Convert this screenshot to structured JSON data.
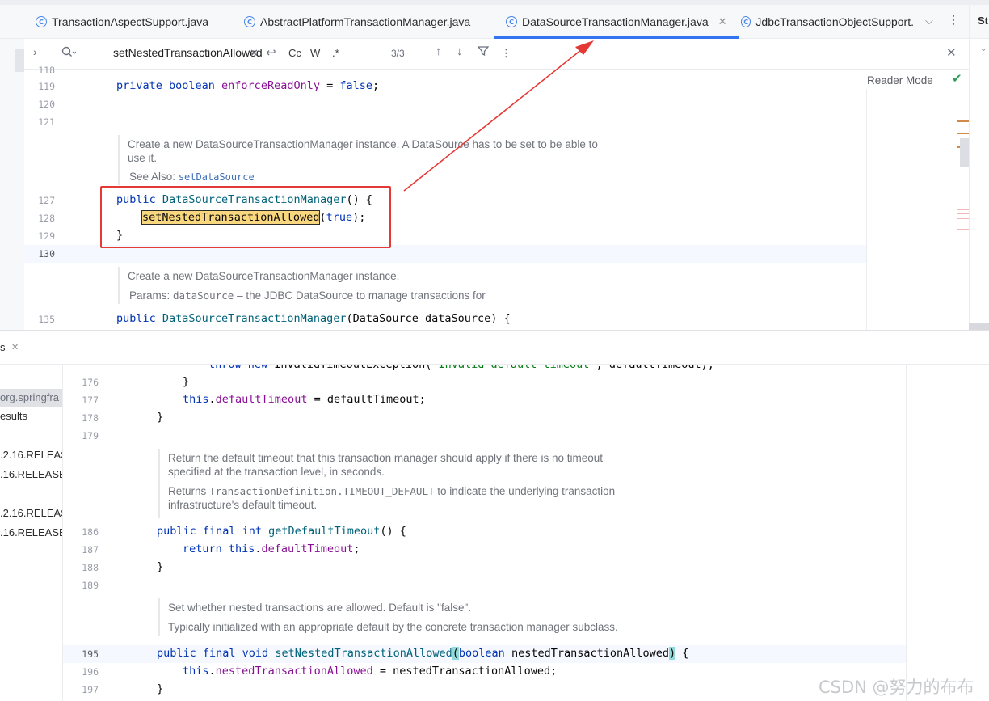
{
  "tabs": [
    {
      "label": "TransactionAspectSupport.java",
      "active": false
    },
    {
      "label": "AbstractPlatformTransactionManager.java",
      "active": false
    },
    {
      "label": "DataSourceTransactionManager.java",
      "active": true
    },
    {
      "label": "JdbcTransactionObjectSupport.",
      "active": false
    }
  ],
  "right_panel": {
    "label": "St"
  },
  "find": {
    "query": "setNestedTransactionAllowed",
    "match_case_label": "Cc",
    "words_label": "W",
    "regex_label": ".*",
    "count": "3/3"
  },
  "reader_mode": "Reader Mode",
  "top_editor": {
    "lines": [
      {
        "num": "118",
        "text": ""
      },
      {
        "num": "119",
        "text": "private boolean enforceReadOnly = false;"
      },
      {
        "num": "120",
        "text": ""
      },
      {
        "num": "121",
        "text": ""
      },
      {
        "num": "127",
        "text": "public DataSourceTransactionManager() {"
      },
      {
        "num": "128",
        "text": "setNestedTransactionAllowed(true);"
      },
      {
        "num": "129",
        "text": "}"
      },
      {
        "num": "130",
        "text": ""
      },
      {
        "num": "135",
        "text": "public DataSourceTransactionManager(DataSource dataSource) {"
      }
    ],
    "doc1": {
      "line1": "Create a new DataSourceTransactionManager instance. A DataSource has to be set to be able to",
      "line2": "use it.",
      "see_also_label": "See Also:",
      "see_also_link": "setDataSource"
    },
    "doc2": {
      "line1": "Create a new DataSourceTransactionManager instance.",
      "params_label": "Params:",
      "params_name": "dataSource",
      "params_text": "– the JDBC DataSource to manage transactions for"
    }
  },
  "panel": {
    "tab_label": "s",
    "tree": [
      {
        "label": "org.springfra",
        "selected": true
      },
      {
        "label": "esults",
        "selected": false
      },
      {
        "label": ".2.16.RELEAS",
        "selected": false
      },
      {
        "label": ".16.RELEASE",
        "selected": false
      },
      {
        "label": ".2.16.RELEAS",
        "selected": false
      },
      {
        "label": ".16.RELEASE",
        "selected": false
      }
    ]
  },
  "bottom_editor": {
    "lines": [
      {
        "num": "175",
        "text": "throw new InvalidTimeoutException(\"Invalid default timeout\", defaultTimeout);"
      },
      {
        "num": "176",
        "text": "}"
      },
      {
        "num": "177",
        "text": "this.defaultTimeout = defaultTimeout;"
      },
      {
        "num": "178",
        "text": "}"
      },
      {
        "num": "179",
        "text": ""
      },
      {
        "num": "186",
        "text": "public final int getDefaultTimeout() {"
      },
      {
        "num": "187",
        "text": "return this.defaultTimeout;"
      },
      {
        "num": "188",
        "text": "}"
      },
      {
        "num": "189",
        "text": ""
      },
      {
        "num": "195",
        "text": "public final void setNestedTransactionAllowed(boolean nestedTransactionAllowed) {"
      },
      {
        "num": "196",
        "text": "this.nestedTransactionAllowed = nestedTransactionAllowed;"
      },
      {
        "num": "197",
        "text": "}"
      }
    ],
    "doc1": {
      "line1": "Return the default timeout that this transaction manager should apply if there is no timeout",
      "line2": "specified at the transaction level, in seconds.",
      "returns_label": "Returns",
      "returns_code": "TransactionDefinition.TIMEOUT_DEFAULT",
      "returns_text": "to indicate the underlying transaction",
      "line4": "infrastructure's default timeout."
    },
    "doc2": {
      "line1": "Set whether nested transactions are allowed. Default is \"false\".",
      "line2": "Typically initialized with an appropriate default by the concrete transaction manager subclass."
    }
  },
  "watermark": "CSDN @努力的布布",
  "colors": {
    "accent": "#3574f0",
    "annotation_red": "#e53935",
    "search_highlight": "#f9d77e",
    "keyword": "#0033b3",
    "field": "#871094"
  }
}
